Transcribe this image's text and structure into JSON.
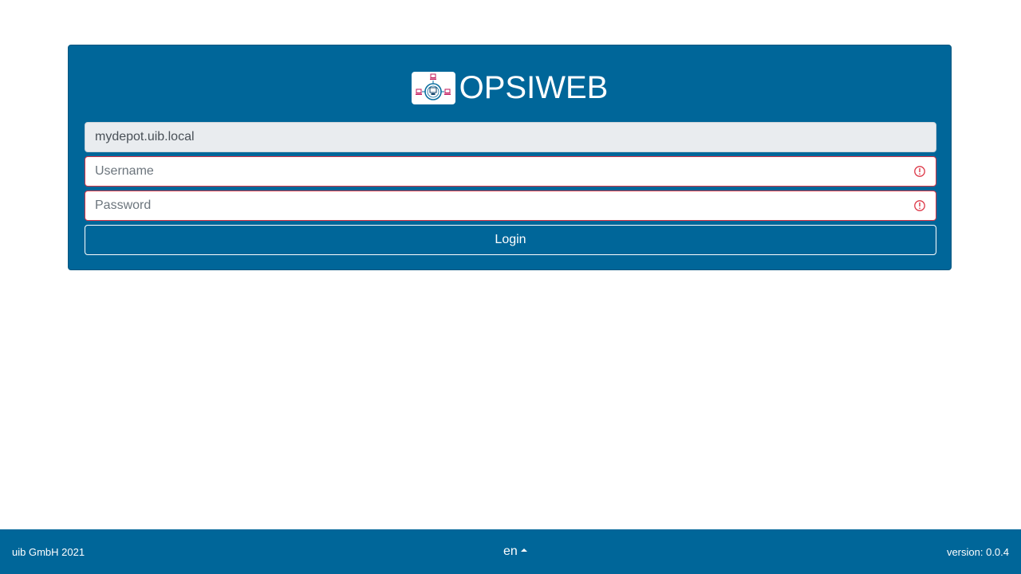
{
  "app": {
    "title": "OPSIWEB",
    "logo_icon": "opsi-network-logo-icon"
  },
  "login_form": {
    "depot_value": "mydepot.uib.local",
    "username_placeholder": "Username",
    "username_value": "",
    "password_placeholder": "Password",
    "password_value": "",
    "login_label": "Login",
    "validation_icon": "exclamation-circle-icon"
  },
  "footer": {
    "copyright": "uib GmbH 2021",
    "language": "en",
    "version": "version: 0.0.4"
  },
  "colors": {
    "brand": "#006699",
    "invalid": "#dc3545",
    "disabled_field": "#e9ecef"
  }
}
